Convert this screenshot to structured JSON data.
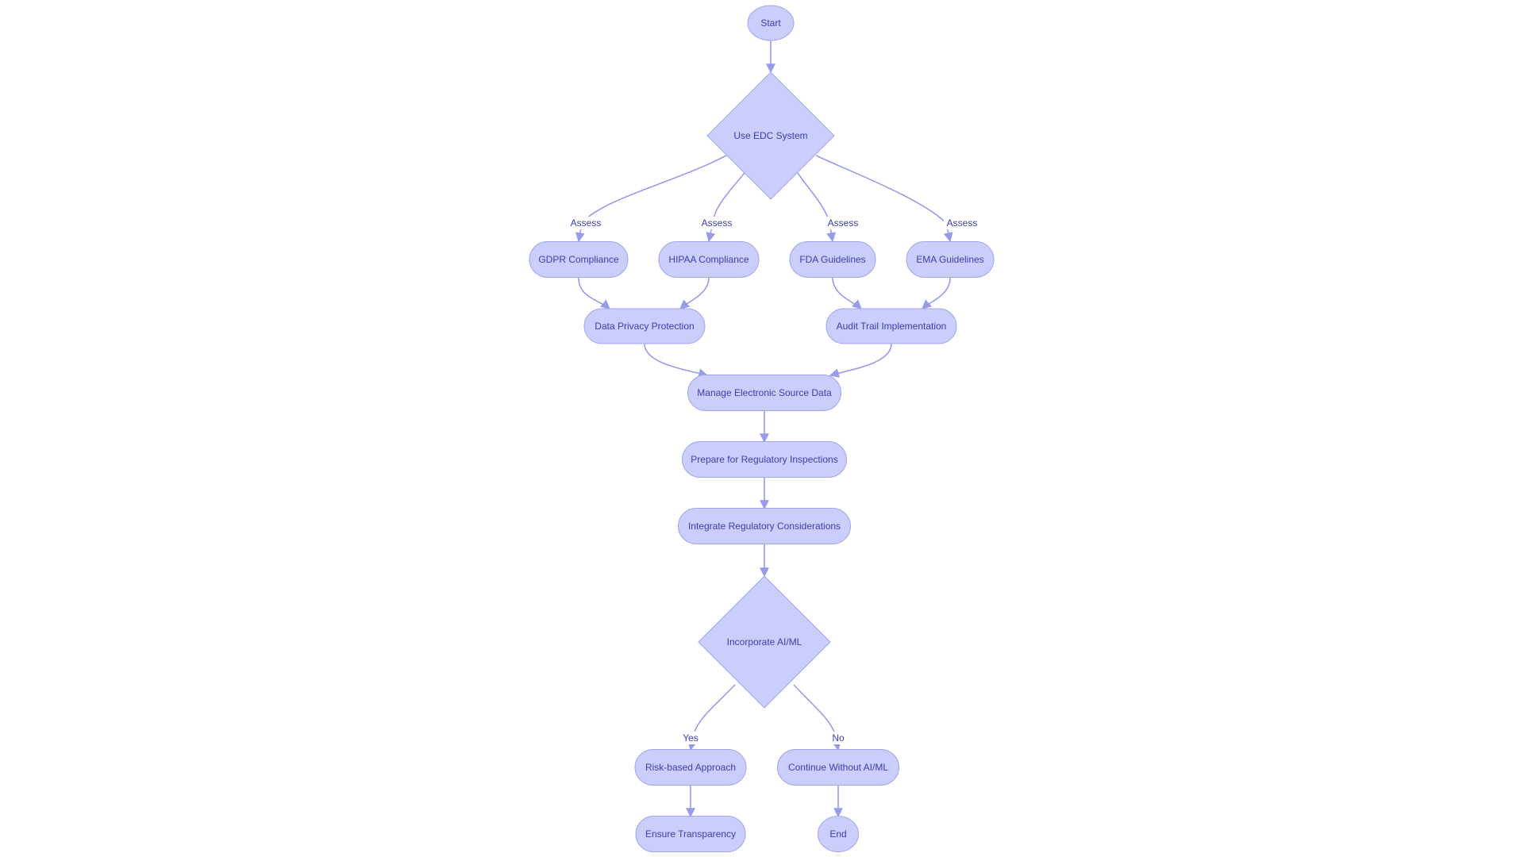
{
  "diagram": {
    "type": "flowchart",
    "colors": {
      "node_fill": "#cbcdfb",
      "node_stroke": "#a3a6ec",
      "text": "#3b3db3",
      "edge": "#979bea"
    },
    "nodes": [
      {
        "id": "start",
        "label": "Start",
        "shape": "circle"
      },
      {
        "id": "edc",
        "label": "Use EDC System",
        "shape": "diamond"
      },
      {
        "id": "gdpr",
        "label": "GDPR Compliance",
        "shape": "stadium"
      },
      {
        "id": "hipaa",
        "label": "HIPAA Compliance",
        "shape": "stadium"
      },
      {
        "id": "fda",
        "label": "FDA Guidelines",
        "shape": "stadium"
      },
      {
        "id": "ema",
        "label": "EMA Guidelines",
        "shape": "stadium"
      },
      {
        "id": "privacy",
        "label": "Data Privacy Protection",
        "shape": "stadium"
      },
      {
        "id": "audit",
        "label": "Audit Trail Implementation",
        "shape": "stadium"
      },
      {
        "id": "manage",
        "label": "Manage Electronic Source Data",
        "shape": "stadium"
      },
      {
        "id": "prepare",
        "label": "Prepare for Regulatory Inspections",
        "shape": "stadium"
      },
      {
        "id": "integrate",
        "label": "Integrate Regulatory Considerations",
        "shape": "stadium"
      },
      {
        "id": "aiml",
        "label": "Incorporate AI/ML",
        "shape": "diamond"
      },
      {
        "id": "risk",
        "label": "Risk-based Approach",
        "shape": "stadium"
      },
      {
        "id": "continue",
        "label": "Continue Without AI/ML",
        "shape": "stadium"
      },
      {
        "id": "transparency",
        "label": "Ensure Transparency",
        "shape": "stadium"
      },
      {
        "id": "end",
        "label": "End",
        "shape": "circle"
      }
    ],
    "edges": [
      {
        "from": "start",
        "to": "edc",
        "label": ""
      },
      {
        "from": "edc",
        "to": "gdpr",
        "label": "Assess"
      },
      {
        "from": "edc",
        "to": "hipaa",
        "label": "Assess"
      },
      {
        "from": "edc",
        "to": "fda",
        "label": "Assess"
      },
      {
        "from": "edc",
        "to": "ema",
        "label": "Assess"
      },
      {
        "from": "gdpr",
        "to": "privacy",
        "label": ""
      },
      {
        "from": "hipaa",
        "to": "privacy",
        "label": ""
      },
      {
        "from": "fda",
        "to": "audit",
        "label": ""
      },
      {
        "from": "ema",
        "to": "audit",
        "label": ""
      },
      {
        "from": "privacy",
        "to": "manage",
        "label": ""
      },
      {
        "from": "audit",
        "to": "manage",
        "label": ""
      },
      {
        "from": "manage",
        "to": "prepare",
        "label": ""
      },
      {
        "from": "prepare",
        "to": "integrate",
        "label": ""
      },
      {
        "from": "integrate",
        "to": "aiml",
        "label": ""
      },
      {
        "from": "aiml",
        "to": "risk",
        "label": "Yes"
      },
      {
        "from": "aiml",
        "to": "continue",
        "label": "No"
      },
      {
        "from": "risk",
        "to": "transparency",
        "label": ""
      },
      {
        "from": "continue",
        "to": "end",
        "label": ""
      }
    ]
  }
}
